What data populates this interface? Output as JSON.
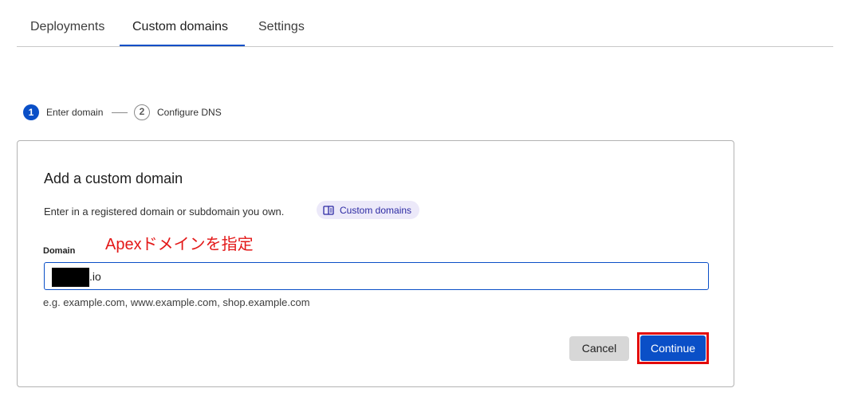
{
  "tabs": [
    {
      "label": "Deployments"
    },
    {
      "label": "Custom domains"
    },
    {
      "label": "Settings"
    }
  ],
  "stepper": {
    "steps": [
      {
        "number": "1",
        "label": "Enter domain"
      },
      {
        "number": "2",
        "label": "Configure DNS"
      }
    ]
  },
  "card": {
    "title": "Add a custom domain",
    "description": "Enter in a registered domain or subdomain you own.",
    "doc_link": "Custom domains",
    "annotation": "Apexドメインを指定",
    "field_label": "Domain",
    "input_value": ".io",
    "helper": "e.g. example.com, www.example.com, shop.example.com",
    "cancel_label": "Cancel",
    "continue_label": "Continue"
  },
  "colors": {
    "accent": "#0a4fc7",
    "annotation_red": "#e31818",
    "chip_bg": "#ece9f9"
  }
}
